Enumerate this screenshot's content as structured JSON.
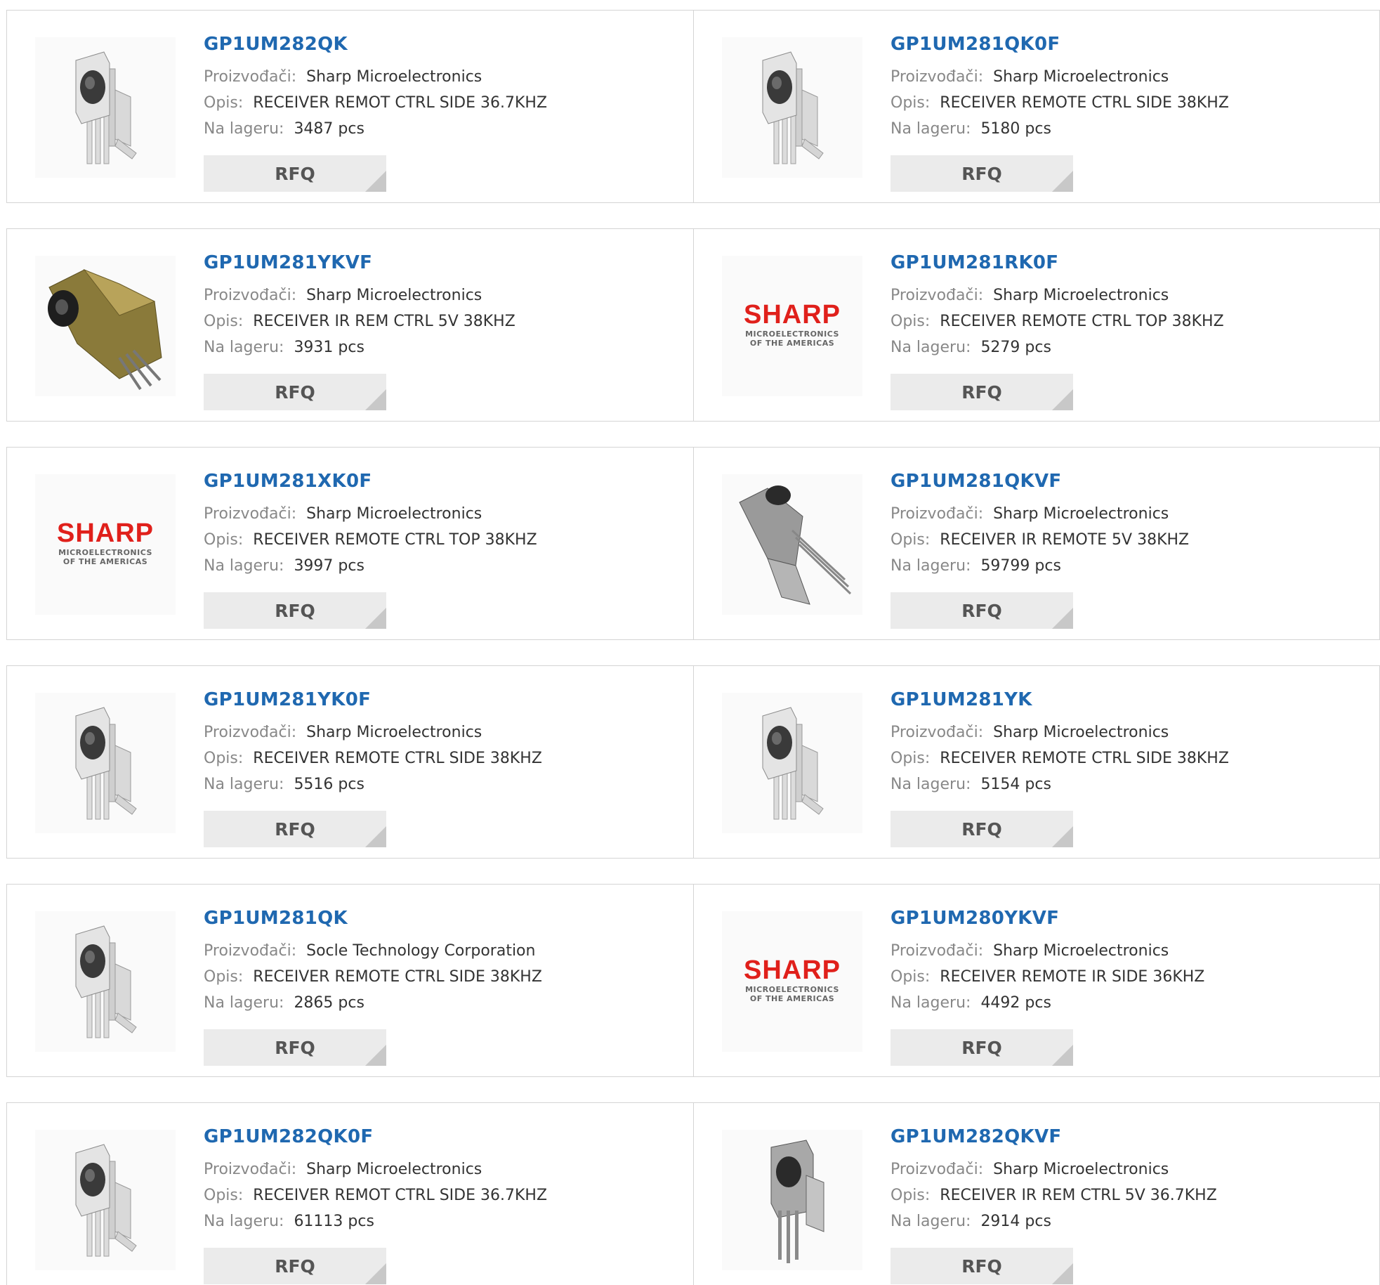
{
  "labels": {
    "manufacturer": "Proizvođači:",
    "description": "Opis:",
    "stock": "Na lageru:",
    "rfq": "RFQ"
  },
  "colors": {
    "part_link": "#1f68b0",
    "label": "#888888",
    "value": "#333333",
    "button_bg": "#ebebeb",
    "sharp_red": "#e0201b"
  },
  "products": [
    {
      "part": "GP1UM282QK",
      "manufacturer": "Sharp Microelectronics",
      "description": "RECEIVER REMOT CTRL SIDE 36.7KHZ",
      "stock": "3487 pcs",
      "image": "ir-receiver-side-icon"
    },
    {
      "part": "GP1UM281QK0F",
      "manufacturer": "Sharp Microelectronics",
      "description": "RECEIVER REMOTE CTRL SIDE 38KHZ",
      "stock": "5180 pcs",
      "image": "ir-receiver-side-icon"
    },
    {
      "part": "GP1UM281YKVF",
      "manufacturer": "Sharp Microelectronics",
      "description": "RECEIVER IR REM CTRL 5V 38KHZ",
      "stock": "3931 pcs",
      "image": "ir-receiver-gold-icon"
    },
    {
      "part": "GP1UM281RK0F",
      "manufacturer": "Sharp Microelectronics",
      "description": "RECEIVER REMOTE CTRL TOP 38KHZ",
      "stock": "5279 pcs",
      "image": "sharp-logo"
    },
    {
      "part": "GP1UM281XK0F",
      "manufacturer": "Sharp Microelectronics",
      "description": "RECEIVER REMOTE CTRL TOP 38KHZ",
      "stock": "3997 pcs",
      "image": "sharp-logo"
    },
    {
      "part": "GP1UM281QKVF",
      "manufacturer": "Sharp Microelectronics",
      "description": "RECEIVER IR REMOTE 5V 38KHZ",
      "stock": "59799 pcs",
      "image": "ir-receiver-angled-icon"
    },
    {
      "part": "GP1UM281YK0F",
      "manufacturer": "Sharp Microelectronics",
      "description": "RECEIVER REMOTE CTRL SIDE 38KHZ",
      "stock": "5516 pcs",
      "image": "ir-receiver-side-icon"
    },
    {
      "part": "GP1UM281YK",
      "manufacturer": "Sharp Microelectronics",
      "description": "RECEIVER REMOTE CTRL SIDE 38KHZ",
      "stock": "5154 pcs",
      "image": "ir-receiver-side-icon"
    },
    {
      "part": "GP1UM281QK",
      "manufacturer": "Socle Technology Corporation",
      "description": "RECEIVER REMOTE CTRL SIDE 38KHZ",
      "stock": "2865 pcs",
      "image": "ir-receiver-side-icon"
    },
    {
      "part": "GP1UM280YKVF",
      "manufacturer": "Sharp Microelectronics",
      "description": "RECEIVER REMOTE IR SIDE 36KHZ",
      "stock": "4492 pcs",
      "image": "sharp-logo"
    },
    {
      "part": "GP1UM282QK0F",
      "manufacturer": "Sharp Microelectronics",
      "description": "RECEIVER REMOT CTRL SIDE 36.7KHZ",
      "stock": "61113 pcs",
      "image": "ir-receiver-side-icon"
    },
    {
      "part": "GP1UM282QKVF",
      "manufacturer": "Sharp Microelectronics",
      "description": "RECEIVER IR REM CTRL 5V 36.7KHZ",
      "stock": "2914 pcs",
      "image": "ir-receiver-metal-icon"
    }
  ],
  "sharp_logo": {
    "brand": "SHARP",
    "line1": "MICROELECTRONICS",
    "line2": "OF THE AMERICAS"
  }
}
